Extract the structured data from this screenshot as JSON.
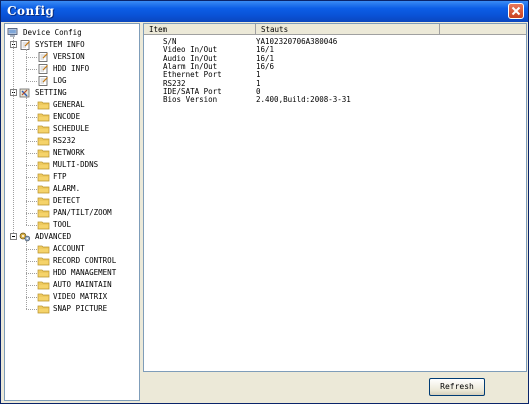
{
  "window": {
    "title": "Config"
  },
  "tree": {
    "root": "Device Config",
    "system_info": {
      "label": "SYSTEM INFO",
      "items": [
        "VERSION",
        "HDD INFO",
        "LOG"
      ]
    },
    "setting": {
      "label": "SETTING",
      "items": [
        "GENERAL",
        "ENCODE",
        "SCHEDULE",
        "RS232",
        "NETWORK",
        "MULTI-DDNS",
        "FTP",
        "ALARM.",
        "DETECT",
        "PAN/TILT/ZOOM",
        "TOOL"
      ]
    },
    "advanced": {
      "label": "ADVANCED",
      "items": [
        "ACCOUNT",
        "RECORD CONTROL",
        "HDD MANAGEMENT",
        "AUTO MAINTAIN",
        "VIDEO MATRIX",
        "SNAP PICTURE"
      ]
    }
  },
  "table": {
    "headers": [
      "Item",
      "Stauts"
    ],
    "rows": [
      [
        "S/N",
        "YA102320706A380046"
      ],
      [
        "Video In/Out",
        "16/1"
      ],
      [
        "Audio In/Out",
        "16/1"
      ],
      [
        "Alarm In/Out",
        "16/6"
      ],
      [
        "Ethernet Port",
        "1"
      ],
      [
        "RS232",
        "1"
      ],
      [
        "IDE/SATA Port",
        "0"
      ],
      [
        "Bios Version",
        "2.400,Build:2008-3-31"
      ]
    ]
  },
  "buttons": {
    "refresh": "Refresh"
  },
  "colors": {
    "titlebar": "#0a52d6",
    "folder": "#f5d36a",
    "panel_border": "#7f9db9"
  }
}
